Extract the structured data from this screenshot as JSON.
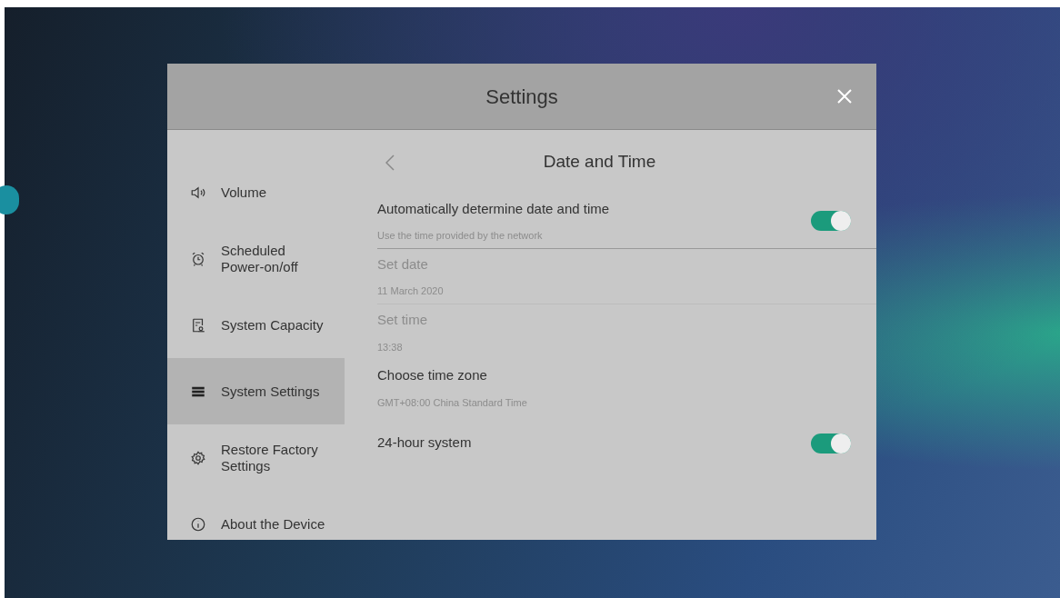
{
  "dialog": {
    "title": "Settings"
  },
  "sidebar": {
    "items": [
      {
        "kind": "volume",
        "label": "Volume",
        "selected": false
      },
      {
        "kind": "alarm",
        "label": "Scheduled Power-on/off",
        "selected": false
      },
      {
        "kind": "capacity",
        "label": "System Capacity",
        "selected": false
      },
      {
        "kind": "system",
        "label": "System Settings",
        "selected": true
      },
      {
        "kind": "gear",
        "label": "Restore Factory Settings",
        "selected": false
      },
      {
        "kind": "info",
        "label": "About the Device",
        "selected": false
      }
    ]
  },
  "panel": {
    "title": "Date and Time",
    "rows": [
      {
        "kind": "toggle",
        "title": "Automatically determine date and time",
        "subtitle": "Use the time provided by the network",
        "on": true,
        "disabled": false,
        "divider": true
      },
      {
        "kind": "value",
        "title": "Set date",
        "subtitle": "11 March 2020",
        "disabled": true,
        "divider": true
      },
      {
        "kind": "value",
        "title": "Set time",
        "subtitle": "13:38",
        "disabled": true,
        "divider": false
      },
      {
        "kind": "value",
        "title": "Choose time zone",
        "subtitle": "GMT+08:00 China Standard Time",
        "disabled": false,
        "divider": false
      },
      {
        "kind": "toggle",
        "title": "24-hour system",
        "on": true,
        "disabled": false,
        "divider": false
      }
    ]
  }
}
